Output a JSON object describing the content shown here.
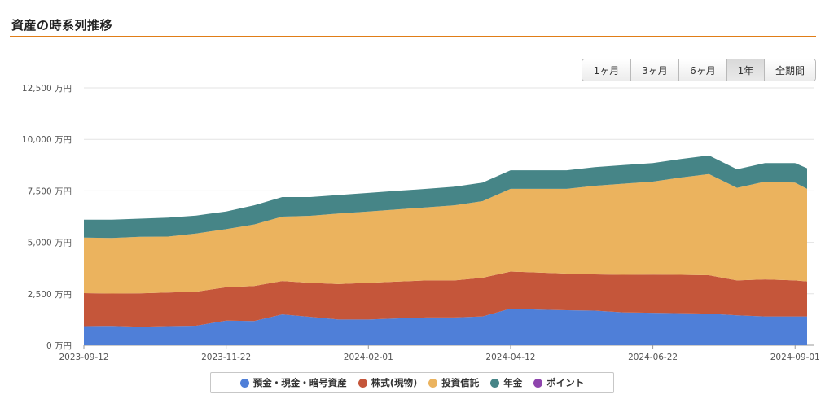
{
  "header": {
    "title": "資産の時系列推移"
  },
  "range_buttons": [
    {
      "label": "1ヶ月",
      "active": false
    },
    {
      "label": "3ヶ月",
      "active": false
    },
    {
      "label": "6ヶ月",
      "active": false
    },
    {
      "label": "1年",
      "active": true
    },
    {
      "label": "全期間",
      "active": false
    }
  ],
  "legend": [
    {
      "label": "預金・現金・暗号資産",
      "color": "#4f7fd8"
    },
    {
      "label": "株式(現物)",
      "color": "#c5563a"
    },
    {
      "label": "投資信託",
      "color": "#ebb35e"
    },
    {
      "label": "年金",
      "color": "#468587"
    },
    {
      "label": "ポイント",
      "color": "#8e44ad"
    }
  ],
  "chart_data": {
    "type": "area",
    "stacked": true,
    "title": "",
    "xlabel": "",
    "ylabel": "",
    "y_unit": "万円",
    "ylim": [
      0,
      12500
    ],
    "y_ticks": [
      0,
      2500,
      5000,
      7500,
      10000,
      12500
    ],
    "y_tick_labels": [
      "0 万円",
      "2,500 万円",
      "5,000 万円",
      "7,500 万円",
      "10,000 万円",
      "12,500 万円"
    ],
    "x_tick_labels": [
      "2023-09-12",
      "2023-11-22",
      "2024-02-01",
      "2024-04-12",
      "2024-06-22",
      "2024-09-01"
    ],
    "x": [
      "2023-09-12",
      "2023-09-26",
      "2023-10-10",
      "2023-10-24",
      "2023-11-07",
      "2023-11-22",
      "2023-12-06",
      "2023-12-20",
      "2024-01-03",
      "2024-01-17",
      "2024-02-01",
      "2024-02-15",
      "2024-03-01",
      "2024-03-15",
      "2024-03-29",
      "2024-04-12",
      "2024-04-26",
      "2024-05-10",
      "2024-05-24",
      "2024-06-07",
      "2024-06-22",
      "2024-07-06",
      "2024-07-20",
      "2024-08-03",
      "2024-08-17",
      "2024-09-01",
      "2024-09-07"
    ],
    "series": [
      {
        "name": "預金・現金・暗号資産",
        "color": "#4f7fd8",
        "values": [
          930,
          940,
          900,
          930,
          950,
          1200,
          1180,
          1500,
          1380,
          1250,
          1250,
          1300,
          1350,
          1350,
          1400,
          1780,
          1730,
          1700,
          1680,
          1600,
          1580,
          1560,
          1540,
          1450,
          1400,
          1400,
          1400
        ]
      },
      {
        "name": "株式(現物)",
        "color": "#c5563a",
        "values": [
          1600,
          1570,
          1620,
          1630,
          1650,
          1620,
          1700,
          1620,
          1650,
          1720,
          1780,
          1790,
          1800,
          1800,
          1880,
          1800,
          1800,
          1780,
          1760,
          1820,
          1850,
          1860,
          1860,
          1700,
          1800,
          1750,
          1700
        ]
      },
      {
        "name": "投資信託",
        "color": "#ebb35e",
        "values": [
          2700,
          2700,
          2750,
          2720,
          2830,
          2820,
          2990,
          3130,
          3260,
          3430,
          3470,
          3510,
          3550,
          3650,
          3720,
          4020,
          4070,
          4120,
          4310,
          4430,
          4520,
          4730,
          4920,
          4500,
          4750,
          4750,
          4500
        ]
      },
      {
        "name": "年金",
        "color": "#468587",
        "values": [
          870,
          890,
          880,
          920,
          870,
          860,
          930,
          950,
          910,
          900,
          900,
          900,
          900,
          900,
          900,
          900,
          900,
          900,
          900,
          900,
          900,
          900,
          900,
          900,
          900,
          950,
          1000
        ]
      },
      {
        "name": "ポイント",
        "color": "#8e44ad",
        "values": [
          0,
          0,
          0,
          0,
          0,
          0,
          0,
          0,
          0,
          0,
          0,
          0,
          0,
          0,
          0,
          0,
          0,
          0,
          0,
          0,
          0,
          0,
          0,
          0,
          0,
          0,
          0
        ]
      }
    ],
    "grid": true,
    "legend_position": "bottom"
  }
}
